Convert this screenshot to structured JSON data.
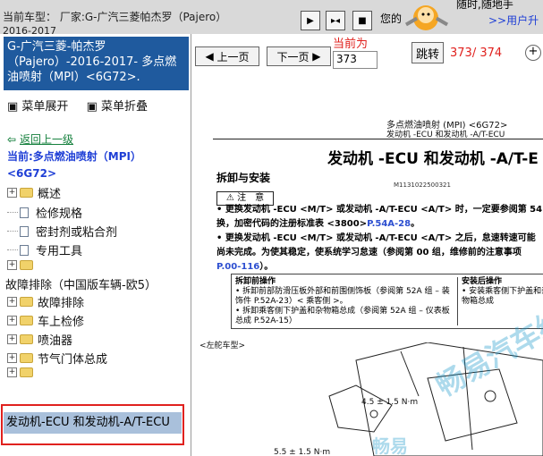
{
  "topbar": {
    "car_label": "当前车型：  厂家:G-广汽三菱帕杰罗（Pajero）",
    "car_label_tail": "2016-2017",
    "welcome": "您的",
    "ad_line1": "随时,随地手",
    "ad_line2": ">>用户升",
    "nav_icons": [
      "play-icon",
      "fit-icon",
      "stop-icon"
    ]
  },
  "sidebar": {
    "header": "G-广汽三菱-帕杰罗（Pajero）-2016-2017- 多点燃油喷射（MPI）<6G72>.",
    "expand_label": "菜单展开",
    "collapse_label": "菜单折叠",
    "back_label": "返回上一级",
    "current_label": "当前:多点燃油喷射（MPI）<6G72>",
    "items": [
      {
        "label": "概述",
        "type": "folder"
      },
      {
        "label": "检修规格",
        "type": "doc"
      },
      {
        "label": "密封剂或粘合剂",
        "type": "doc"
      },
      {
        "label": "专用工具",
        "type": "doc"
      },
      {
        "label": "",
        "type": "folder"
      },
      {
        "label": "故障排除（中国版车辆-欧5）",
        "type": "text"
      },
      {
        "label": "故障排除",
        "type": "folder"
      },
      {
        "label": "车上检修",
        "type": "folder"
      },
      {
        "label": "喷油器",
        "type": "folder"
      },
      {
        "label": "节气门体总成",
        "type": "folder"
      },
      {
        "label": "",
        "type": "folder"
      }
    ],
    "selected_label": "发动机-ECU 和发动机-A/T-ECU",
    "highlight_color": "#e0211e"
  },
  "pager": {
    "prev_label": "上一页",
    "next_label": "下一页",
    "current_page_label": "当前为",
    "current_page_value": "373",
    "jump_label": "跳转",
    "page_count": "373/ 374",
    "zoom_icon": "zoom-in-icon"
  },
  "document": {
    "header_line1": "多点燃油喷射 (MPI) <6G72>",
    "header_line2": "发动机 -ECU 和发动机 -A/T-ECU",
    "title": "发动机 -ECU 和发动机 -A/T-E",
    "section": "拆卸与安装",
    "code": "M1131022500321",
    "notice": "注　意",
    "bullet1_a": "• 更换发动机 -ECU <M/T> 或发动机 -A/T-ECU <A/T> 时，一定要参阅第 54",
    "bullet1_b": "换，加密代码的注册标准表 <3800>",
    "bullet1_ref": "P.54A-28",
    "bullet2_a": "• 更换发动机 -ECU <M/T> 或发动机 -A/T-ECU <A/T> 之后，怠速转速可能",
    "bullet2_b": "尚未完成。为使其稳定，使系统学习怠速（参阅第 00 组，维修前的注意事项",
    "bullet2_ref": "P.00-116",
    "steps_removal_head": "拆卸前操作",
    "steps_removal_1": "• 拆卸前部防滑压板外部和前围侧饰板（参阅第 52A 组 – 装饰件 P.52A-23）< 乘客侧 >。",
    "steps_removal_2": "• 拆卸乘客侧下护盖和杂物箱总成（参阅第 52A 组 – 仪表板总成 P.52A-15）",
    "steps_install_head": "安装后操作",
    "steps_install_1": "• 安装乘客侧下护盖和杂物箱总成",
    "model_note": "<左舵车型>",
    "torque1": "4.5 ± 1.5 N·m",
    "torque2": "5.5 ± 1.5 N·m",
    "watermark1": "畅易",
    "watermark2": "畅易汽车维修"
  }
}
